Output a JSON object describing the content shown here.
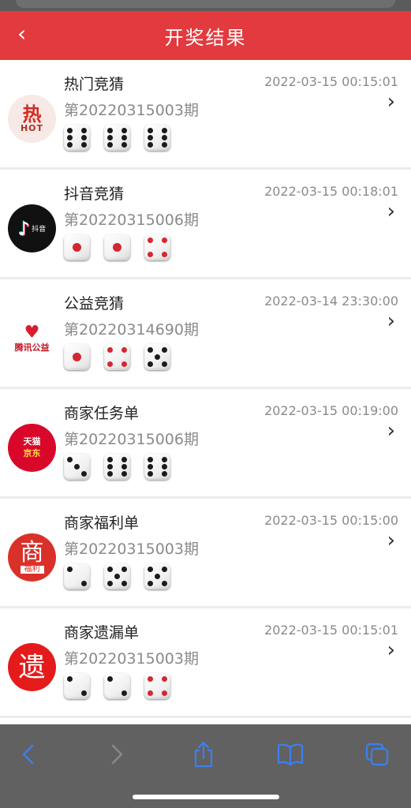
{
  "header": {
    "back_label": "‹",
    "title": "开奖结果"
  },
  "colors": {
    "header_bg": "#e23a3e",
    "pip_black": "#1b1b1b",
    "pip_red": "#d32830",
    "toolbar_bg": "#616161",
    "toolbar_icon": "#3b7ff0"
  },
  "rows": [
    {
      "name": "热门竞猜",
      "issue": "第20220315003期",
      "time": "2022-03-15 00:15:01",
      "logo": {
        "icon": "hot-flame-logo",
        "text": "热",
        "sub": "HOT"
      },
      "dice": [
        6,
        6,
        6
      ]
    },
    {
      "name": "抖音竞猜",
      "issue": "第20220315006期",
      "time": "2022-03-15 00:18:01",
      "logo": {
        "icon": "tiktok-logo",
        "text": "抖音"
      },
      "dice": [
        1,
        1,
        4
      ]
    },
    {
      "name": "公益竞猜",
      "issue": "第20220314690期",
      "time": "2022-03-14 23:30:00",
      "logo": {
        "icon": "tencent-charity-logo",
        "text": "腾讯公益"
      },
      "dice": [
        1,
        4,
        5
      ]
    },
    {
      "name": "商家任务单",
      "issue": "第20220315006期",
      "time": "2022-03-15 00:19:00",
      "logo": {
        "icon": "shop-tasks-logo",
        "text": "天猫",
        "sub": "京东"
      },
      "dice": [
        3,
        6,
        6
      ]
    },
    {
      "name": "商家福利单",
      "issue": "第20220315003期",
      "time": "2022-03-15 00:15:00",
      "logo": {
        "icon": "shop-welfare-logo",
        "text": "商",
        "sub": "福利"
      },
      "dice": [
        2,
        5,
        5
      ]
    },
    {
      "name": "商家遗漏单",
      "issue": "第20220315003期",
      "time": "2022-03-15 00:15:01",
      "logo": {
        "icon": "shop-missed-logo",
        "text": "遗"
      },
      "dice": [
        2,
        2,
        4
      ]
    }
  ],
  "toolbar": {
    "items": [
      "back-icon",
      "forward-icon",
      "share-icon",
      "bookmarks-icon",
      "tabs-icon"
    ]
  }
}
